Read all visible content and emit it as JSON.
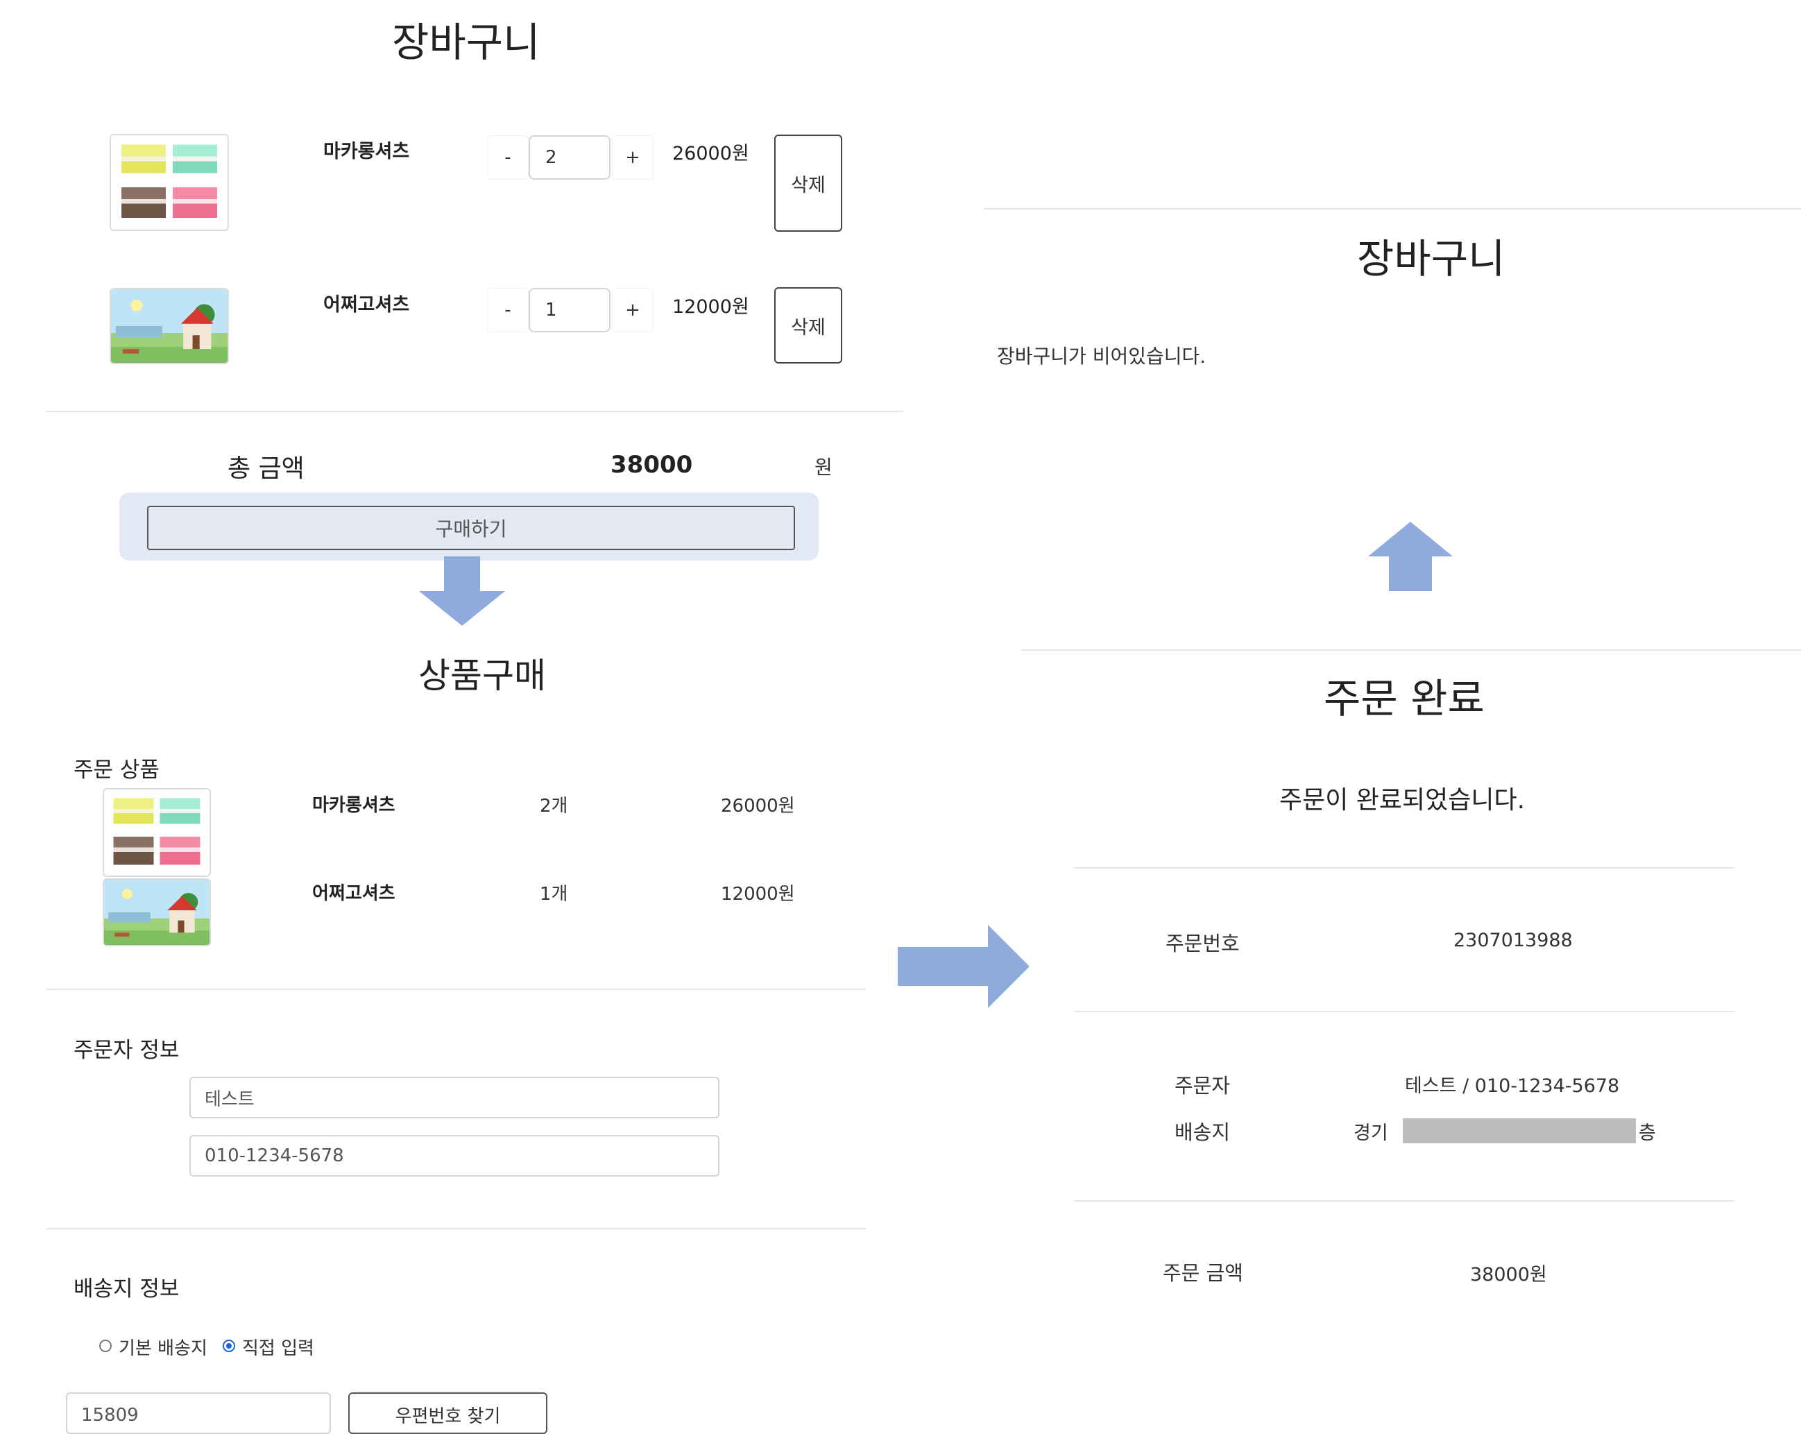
{
  "cart": {
    "title": "장바구니",
    "items": [
      {
        "name": "마카롱셔츠",
        "qty": "2",
        "price": "26000원",
        "minus": "-",
        "plus": "+",
        "delete_label": "삭제"
      },
      {
        "name": "어쩌고셔츠",
        "qty": "1",
        "price": "12000원",
        "minus": "-",
        "plus": "+",
        "delete_label": "삭제"
      }
    ],
    "total_label": "총 금액",
    "total_value": "38000",
    "total_unit": "원",
    "buy_label": "구매하기"
  },
  "purchase": {
    "title": "상품구매",
    "order_items_label": "주문 상품",
    "order_items": [
      {
        "name": "마카롱셔츠",
        "qty": "2개",
        "price": "26000원"
      },
      {
        "name": "어쩌고셔츠",
        "qty": "1개",
        "price": "12000원"
      }
    ],
    "orderer_label": "주문자 정보",
    "orderer_name": "테스트",
    "orderer_phone": "010-1234-5678",
    "shipping_label": "배송지 정보",
    "radio_default": "기본 배송지",
    "radio_direct": "직접 입력",
    "selected_option": "직접 입력",
    "postcode": "15809",
    "postcode_search": "우편번호 찾기"
  },
  "empty_cart": {
    "title": "장바구니",
    "message": "장바구니가 비어있습니다."
  },
  "complete": {
    "title": "주문 완료",
    "message": "주문이 완료되었습니다.",
    "order_no_label": "주문번호",
    "order_no": "2307013988",
    "orderer_label": "주문자",
    "orderer": "테스트 / 010-1234-5678",
    "address_label": "배송지",
    "address_start": "경기 ",
    "address_end": "층",
    "amount_label": "주문 금액",
    "amount": "38000원"
  },
  "colors": {
    "arrow": "#8faadc",
    "buy_bg": "#e2e8f4",
    "divider": "#e6e6e6"
  },
  "icons": [
    "macaron-image",
    "landscape-house-image",
    "arrow-down-icon",
    "arrow-up-icon",
    "arrow-right-icon"
  ]
}
